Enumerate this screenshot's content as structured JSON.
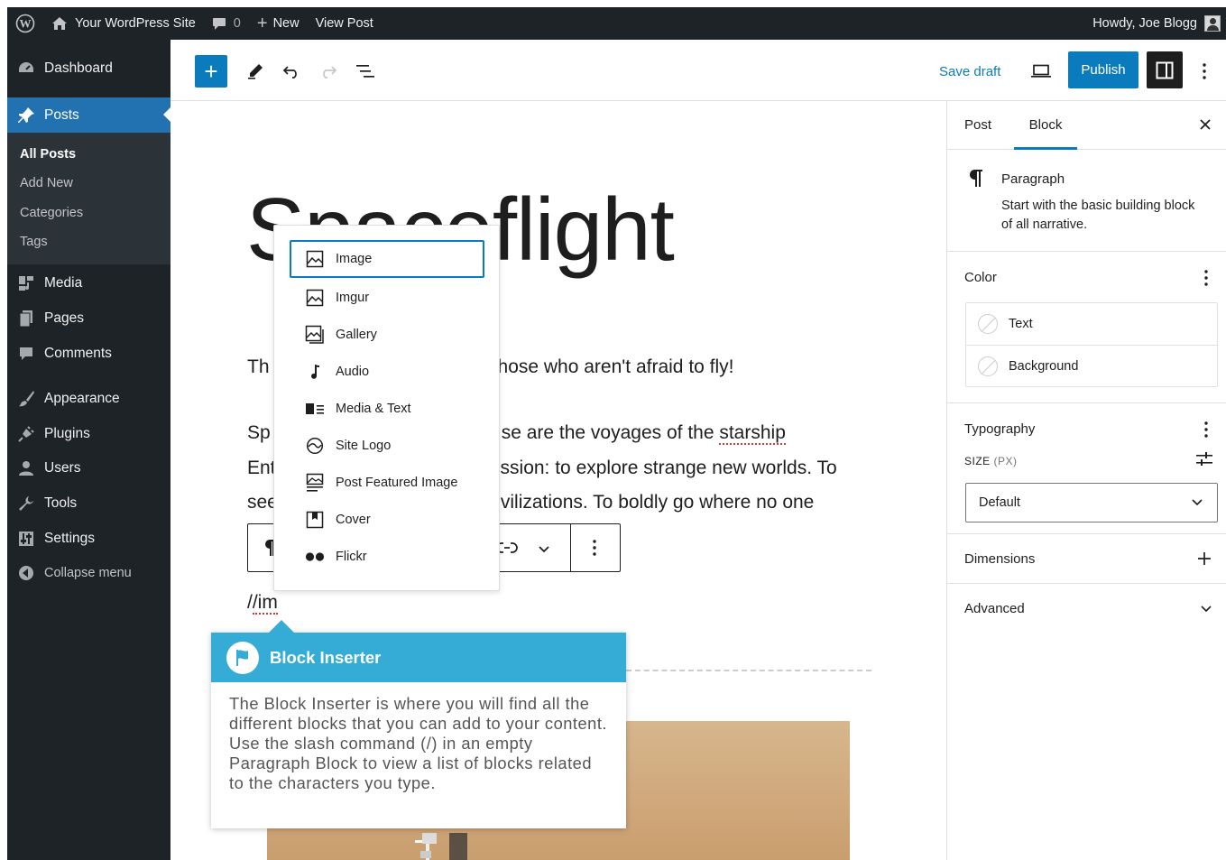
{
  "adminbar": {
    "site_name": "Your WordPress Site",
    "comments_count": "0",
    "new_label": "New",
    "view_post": "View Post",
    "howdy": "Howdy, Joe Blogg"
  },
  "sidebar": {
    "dashboard": "Dashboard",
    "posts": "Posts",
    "posts_sub": [
      "All Posts",
      "Add New",
      "Categories",
      "Tags"
    ],
    "items": [
      "Media",
      "Pages",
      "Comments"
    ],
    "items2": [
      "Appearance",
      "Plugins",
      "Users",
      "Tools",
      "Settings"
    ],
    "collapse": "Collapse menu"
  },
  "toolbar": {
    "save_draft": "Save draft",
    "publish": "Publish"
  },
  "panel": {
    "tab_post": "Post",
    "tab_block": "Block",
    "block_name": "Paragraph",
    "block_desc_1": "Start with the basic building block",
    "block_desc_2": "of all narrative.",
    "color_title": "Color",
    "color_text": "Text",
    "color_background": "Background",
    "typography_title": "Typography",
    "size_label": "SIZE",
    "size_unit": "(PX)",
    "size_value": "Default",
    "dimensions_title": "Dimensions",
    "advanced_title": "Advanced"
  },
  "canvas": {
    "title_left": "S",
    "title_visible": "Spaceflight",
    "title_right": "flight",
    "p1_left": "Th",
    "p1_right": "hose who aren't afraid to fly!",
    "p2_l1_left": "Sp",
    "p2_l1_right": "se are the voyages of the ",
    "p2_l1_word": "starship",
    "p2_l2_left": "Ent",
    "p2_l2_right": "ssion: to explore strange new worlds. To",
    "p2_l3_left": "see",
    "p2_l3_right": "vilizations. To boldly go where no one",
    "slash_cmd": "/im"
  },
  "inserter": {
    "items": [
      "Image",
      "Imgur",
      "Gallery",
      "Audio",
      "Media & Text",
      "Site Logo",
      "Post Featured Image",
      "Cover",
      "Flickr"
    ]
  },
  "tooltip": {
    "title": "Block Inserter",
    "body": "The Block Inserter is where you will find all the different blocks that you can add to your content. Use the slash command (/) in an empty Paragraph Block to view a list of blocks related to the characters you type."
  },
  "colors": {
    "admin_dark": "#1d2327",
    "accent": "#0a7cbe",
    "posts_active": "#2271b1",
    "tooltip_head": "#35acd6"
  }
}
